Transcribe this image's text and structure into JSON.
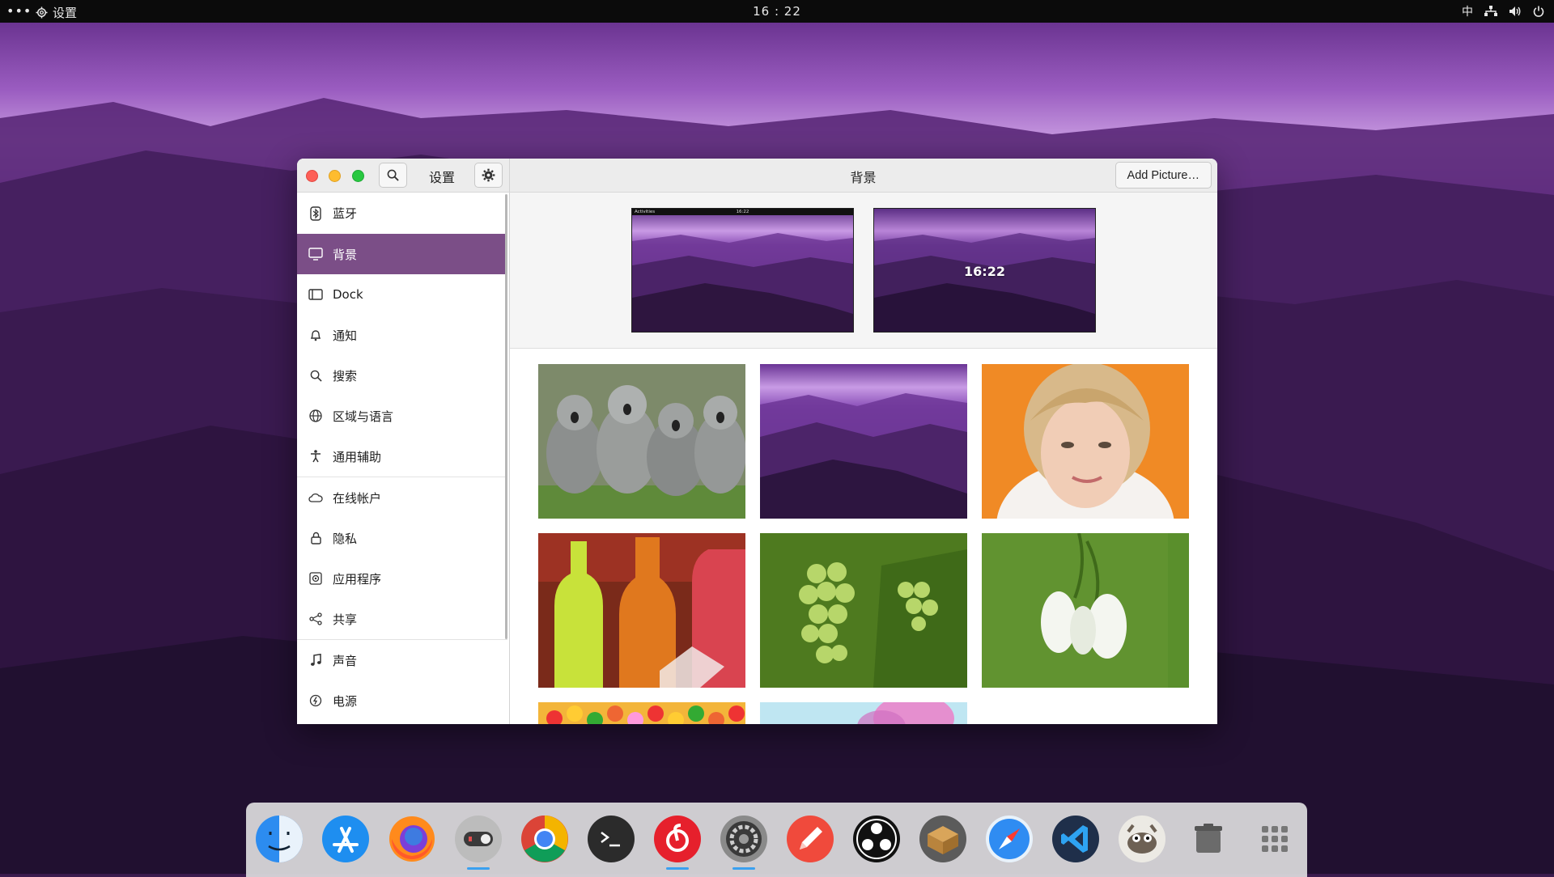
{
  "topbar": {
    "app_name": "设置",
    "clock": "16 : 22",
    "input_method": "中"
  },
  "window": {
    "left_title": "设置",
    "panel_title": "背景",
    "add_button_label": "Add Picture…"
  },
  "sidebar": {
    "items": [
      {
        "label": "蓝牙",
        "icon": "bluetooth-icon"
      },
      {
        "label": "背景",
        "icon": "display-icon"
      },
      {
        "label": "Dock",
        "icon": "dock-icon"
      },
      {
        "label": "通知",
        "icon": "bell-icon"
      },
      {
        "label": "搜索",
        "icon": "search-icon"
      },
      {
        "label": "区域与语言",
        "icon": "globe-icon"
      },
      {
        "label": "通用辅助",
        "icon": "accessibility-icon"
      },
      {
        "label": "在线帐户",
        "icon": "cloud-icon"
      },
      {
        "label": "隐私",
        "icon": "lock-icon"
      },
      {
        "label": "应用程序",
        "icon": "apps-icon"
      },
      {
        "label": "共享",
        "icon": "share-icon"
      },
      {
        "label": "声音",
        "icon": "music-note-icon"
      },
      {
        "label": "电源",
        "icon": "power-icon"
      }
    ],
    "active_index": 1
  },
  "previews": {
    "desktop_bar_left": "Activities",
    "desktop_bar_center": "16:22",
    "lock_time": "16:22"
  },
  "wallpapers": [
    "koalas",
    "purple-hills",
    "portrait-orange",
    "bottled-drinks",
    "green-grapes",
    "snowdrop-flowers",
    "fruit-candy",
    "pink-flower"
  ],
  "dock": {
    "apps": [
      "finder-icon",
      "app-store-icon",
      "firefox-icon",
      "toggle-settings-icon",
      "chrome-icon",
      "terminal-icon",
      "netease-music-icon",
      "system-settings-icon",
      "sketch-pencil-icon",
      "obs-icon",
      "package-box-icon",
      "safari-icon",
      "vscode-icon",
      "gimp-icon",
      "trash-icon",
      "app-grid-icon"
    ],
    "running": [
      "toggle-settings-icon",
      "netease-music-icon",
      "system-settings-icon"
    ]
  },
  "colors": {
    "accent": "#7b4e87",
    "topbar": "#0b0b0b",
    "running_indicator": "#3aa0f0"
  }
}
